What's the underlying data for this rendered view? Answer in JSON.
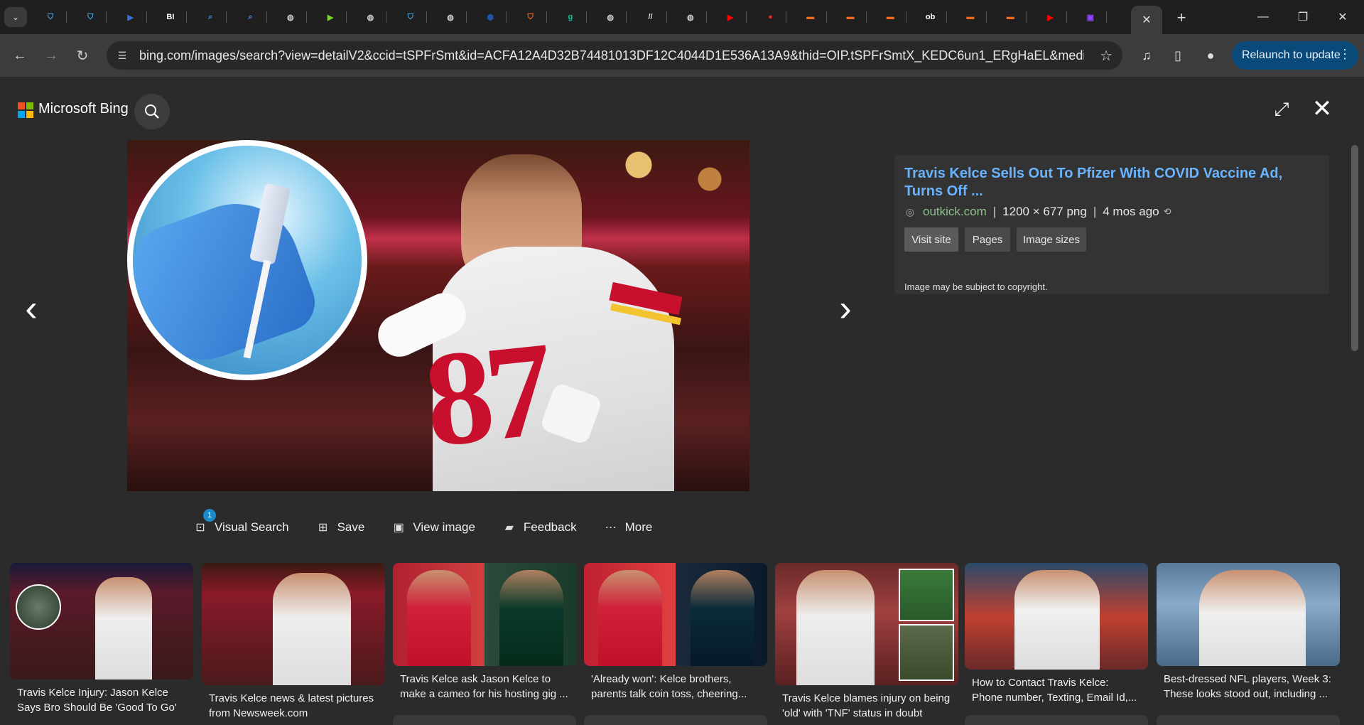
{
  "browser": {
    "tabs": [
      {
        "icon": "shield-icon",
        "color": "#4aa3df",
        "glyph": "⛉"
      },
      {
        "icon": "shield-icon",
        "color": "#4aa3df",
        "glyph": "⛉"
      },
      {
        "icon": "play-box-icon",
        "color": "#3b6fd4",
        "glyph": "▶"
      },
      {
        "icon": "business-insider-icon",
        "color": "#ffffff",
        "glyph": "BI"
      },
      {
        "icon": "search-icon",
        "color": "#4a90e2",
        "glyph": "⌕"
      },
      {
        "icon": "search-icon",
        "color": "#4a90e2",
        "glyph": "⌕"
      },
      {
        "icon": "globe-icon",
        "color": "#cccccc",
        "glyph": "◍"
      },
      {
        "icon": "play-circle-icon",
        "color": "#7bd321",
        "glyph": "▶"
      },
      {
        "icon": "globe-icon",
        "color": "#cccccc",
        "glyph": "◍"
      },
      {
        "icon": "shield-icon",
        "color": "#4aa3df",
        "glyph": "⛉"
      },
      {
        "icon": "globe-icon",
        "color": "#cccccc",
        "glyph": "◍"
      },
      {
        "icon": "hexagon-icon",
        "color": "#2255aa",
        "glyph": "⬢"
      },
      {
        "icon": "brave-shield-icon",
        "color": "#ff6a1a",
        "glyph": "⛉"
      },
      {
        "icon": "grammarly-icon",
        "color": "#15c39a",
        "glyph": "g"
      },
      {
        "icon": "globe-icon",
        "color": "#cccccc",
        "glyph": "◍"
      },
      {
        "icon": "slash-logo-icon",
        "color": "#dddddd",
        "glyph": "//"
      },
      {
        "icon": "globe-icon",
        "color": "#cccccc",
        "glyph": "◍"
      },
      {
        "icon": "youtube-icon",
        "color": "#ff0000",
        "glyph": "▶"
      },
      {
        "icon": "mic-icon",
        "color": "#e0282e",
        "glyph": "●"
      },
      {
        "icon": "bookmark-icon",
        "color": "#f26b1d",
        "glyph": "▬"
      },
      {
        "icon": "bookmark-icon",
        "color": "#f26b1d",
        "glyph": "▬"
      },
      {
        "icon": "bookmark-icon",
        "color": "#f26b1d",
        "glyph": "▬"
      },
      {
        "icon": "ob-logo-icon",
        "color": "#ffffff",
        "glyph": "ob"
      },
      {
        "icon": "bookmark-icon",
        "color": "#f26b1d",
        "glyph": "▬"
      },
      {
        "icon": "bookmark-icon",
        "color": "#f26b1d",
        "glyph": "▬"
      },
      {
        "icon": "youtube-icon",
        "color": "#ff0000",
        "glyph": "▶"
      },
      {
        "icon": "twitch-icon",
        "color": "#9146ff",
        "glyph": "▣"
      }
    ],
    "url": "bing.com/images/search?view=detailV2&ccid=tSPFrSmt&id=ACFA12A4D32B74481013DF12C4044D1E536A13A9&thid=OIP.tSPFrSmtX_KEDC6un1_ERgHaEL&mediaurl=htt...",
    "relaunch_label": "Relaunch to update"
  },
  "bing": {
    "brand": "Microsoft Bing"
  },
  "detail": {
    "title": "Travis Kelce Sells Out To Pfizer With COVID Vaccine Ad, Turns Off ...",
    "site": "outkick.com",
    "dimensions": "1200 × 677 png",
    "age": "4 mos ago",
    "buttons": [
      "Visit site",
      "Pages",
      "Image sizes"
    ],
    "copyright": "Image may be subject to copyright."
  },
  "actions": {
    "visual_search": "Visual Search",
    "visual_search_badge": "1",
    "save": "Save",
    "view_image": "View image",
    "feedback": "Feedback",
    "more": "More"
  },
  "thumbnails": [
    {
      "caption": "Travis Kelce Injury: Jason Kelce Says Bro Should Be 'Good To Go'"
    },
    {
      "caption": "Travis Kelce news & latest pictures from Newsweek.com"
    },
    {
      "caption": "Travis Kelce ask Jason Kelce to make a cameo for his hosting gig ..."
    },
    {
      "caption": "'Already won': Kelce brothers, parents talk coin toss, cheering..."
    },
    {
      "caption": "Travis Kelce blames injury on being 'old' with 'TNF' status in doubt"
    },
    {
      "caption": "How to Contact Travis Kelce: Phone number, Texting, Email Id,..."
    },
    {
      "caption": "Best-dressed NFL players, Week 3: These looks stood out, including ..."
    }
  ]
}
